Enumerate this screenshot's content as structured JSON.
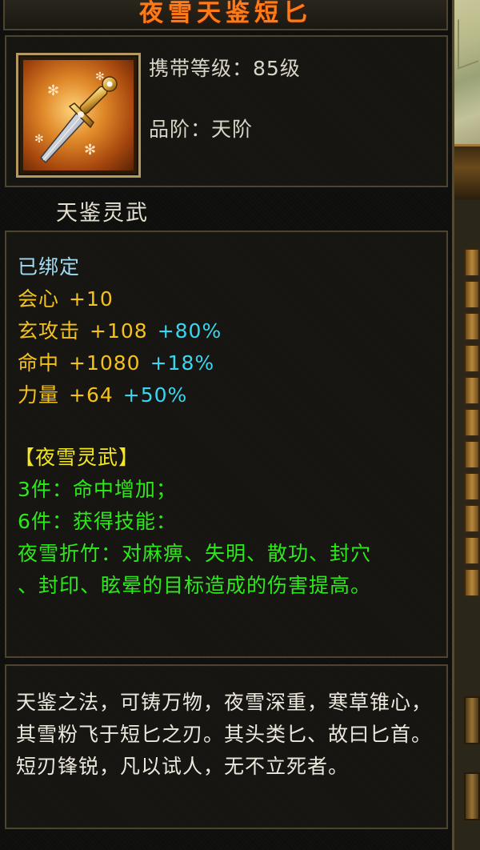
{
  "item": {
    "name": "夜雪天鉴短匕",
    "level_req": "携带等级：85级",
    "grade": "品阶：天阶",
    "category": "天鉴灵武"
  },
  "stats": {
    "bound": "已绑定",
    "crit_label": "会心",
    "crit_flat": "+10",
    "mystic_label": "玄攻击",
    "mystic_flat": "+108",
    "mystic_pct": "+80%",
    "hit_label": "命中",
    "hit_flat": "+1080",
    "hit_pct": "+18%",
    "str_label": "力量",
    "str_flat": "+64",
    "str_pct": "+50%"
  },
  "set": {
    "name": "【夜雪灵武】",
    "bonus3": "3件：命中增加；",
    "bonus6": "6件：获得技能：",
    "skill_line1": "夜雪折竹：对麻痹、失明、散功、封穴",
    "skill_line2": "、封印、眩晕的目标造成的伤害提高。"
  },
  "description": "天鉴之法，可铸万物，夜雪深重，寒草锥心，其雪粉飞于短匕之刃。其头类匕、故曰匕首。短刃锋锐，凡以试人，无不立死者。",
  "colors": {
    "title": "#ff7a18",
    "bound": "#9fdcf2",
    "stat": "#f4c21e",
    "percent": "#38d6f0",
    "set_effect": "#2cea1a",
    "set_name": "#f4e81e"
  },
  "icons": {
    "item_icon": "dagger-icon"
  }
}
